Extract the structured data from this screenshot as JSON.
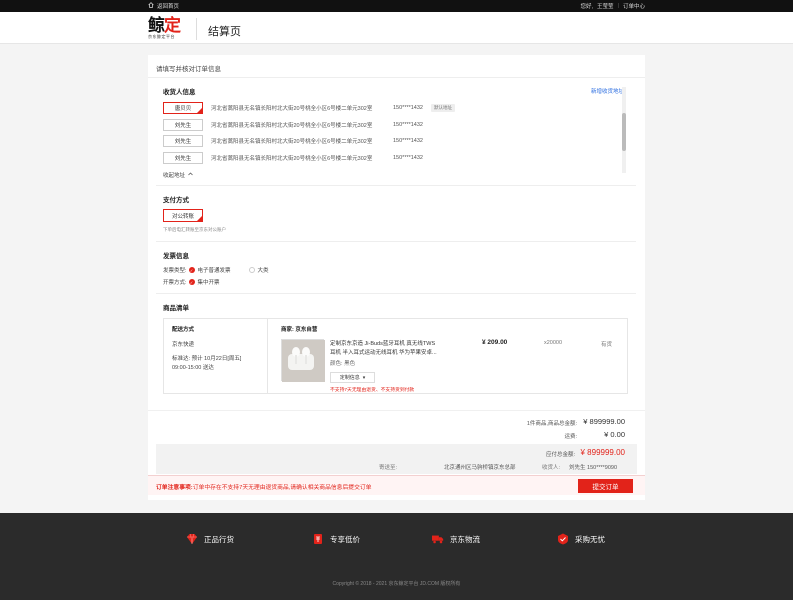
{
  "topbar": {
    "home_label": "返回首页",
    "greeting": "您好,",
    "username": "王莹莹",
    "order_center": "订单中心"
  },
  "header": {
    "logo_main_a": "鲸",
    "logo_main_b": "定",
    "logo_sub": "京东鲸定平台",
    "page_title": "结算页"
  },
  "card": {
    "heading": "请填写并核对订单信息"
  },
  "receiver": {
    "title": "收货人信息",
    "add_link": "新增收货地址",
    "collapse_label": "收起地址",
    "addresses": [
      {
        "name": "唐贝贝",
        "address": "河北省蒿阳县无名镇长阳村北大街20号桃全小区6号楼二单元302室",
        "phone": "150****1432",
        "badge": "默认地址"
      },
      {
        "name": "刘先生",
        "address": "河北省蒿阳县无名镇长阳村北大街20号桃全小区6号楼二单元302室",
        "phone": "150****1432"
      },
      {
        "name": "刘先生",
        "address": "河北省蒿阳县无名镇长阳村北大街20号桃全小区6号楼二单元302室",
        "phone": "150****1432"
      },
      {
        "name": "刘先生",
        "address": "河北省蒿阳县无名镇长阳村北大街20号桃全小区6号楼二单元302室",
        "phone": "150****1432"
      }
    ]
  },
  "payment": {
    "title": "支付方式",
    "method": "对公转账",
    "note": "下单后电汇转账至京东对公账户"
  },
  "invoice": {
    "title": "发票信息",
    "type_label": "发票类型:",
    "type_selected": "电子普通发票",
    "type_other": "大类",
    "mode_label": "开票方式:",
    "mode_selected": "集中开票"
  },
  "goods": {
    "title": "商品清单",
    "ship_title": "配送方式",
    "ship_method": "京东快递",
    "ship_time_label": "标准达:",
    "ship_time": "预计 10月22日[周五]",
    "ship_window": "09:00-15:00 送达",
    "seller_label": "商家:",
    "seller": "京东自营",
    "product_name_1": "定制京东京造 Ji-Buds蓝牙耳机 真无线TWS",
    "product_name_2": "耳机 半入耳式运动无线耳机 华为苹果安卓...",
    "color_label": "颜色:",
    "color": "黑色",
    "custom_btn": "定制信息",
    "warning": "不支持7天无理由退货、不支持货到付款",
    "price": "¥ 209.00",
    "qty": "x20000",
    "stock": "有货"
  },
  "summary": {
    "count_text": "1件商品,商品总金额:",
    "goods_total": "¥ 899999.00",
    "freight_label": "运费:",
    "freight": "¥ 0.00",
    "payable_label": "应付总金额:",
    "payable": "¥ 899999.00",
    "ship_to_label": "寄送至:",
    "ship_to": "北京通州区马驹桥镇京东总部",
    "receiver_label": "收货人:",
    "receiver": "刘先生 150****9090"
  },
  "notice": {
    "label": "订单注意事项:",
    "text": "订单中存在不支持7天无理由退货商品,请确认相关商品信息后提交订单",
    "submit": "提交订单"
  },
  "footer": {
    "features": [
      {
        "icon": "diamond-icon",
        "label": "正品行货"
      },
      {
        "icon": "price-tag-icon",
        "label": "专享低价"
      },
      {
        "icon": "truck-icon",
        "label": "京东物流"
      },
      {
        "icon": "shield-icon",
        "label": "采购无忧"
      }
    ],
    "copyright": "Copyright © 2018 - 2021 京东鲸定平台 JD.COM 版权所有"
  },
  "colors": {
    "accent": "#e2231a",
    "link": "#2b6de0",
    "footer_bg": "#2b2b2b"
  }
}
